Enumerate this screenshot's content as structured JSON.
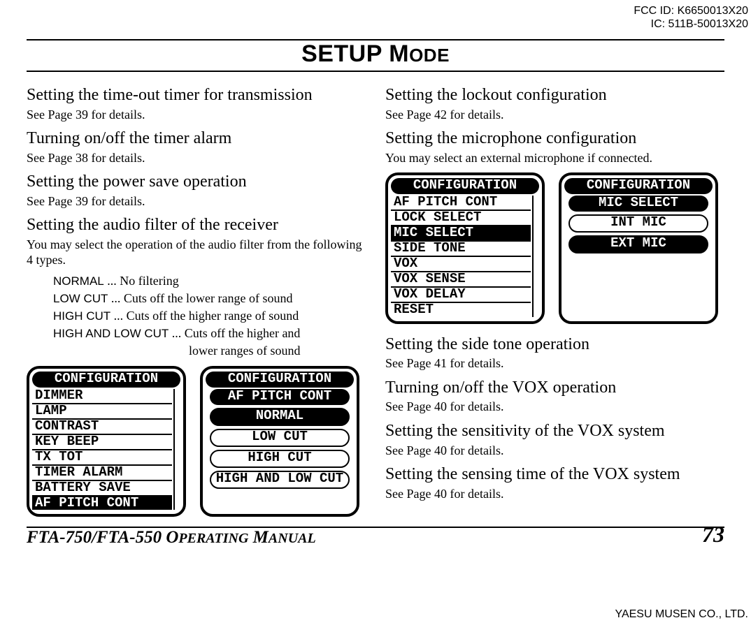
{
  "ids": {
    "fcc": "FCC ID: K6650013X20",
    "ic": "IC: 511B-50013X20"
  },
  "title": {
    "big": "SETUP M",
    "sc": "ODE"
  },
  "left": {
    "s1_h": "Setting the time-out timer for transmission",
    "s1_t": "See Page 39 for details.",
    "s2_h": "Turning on/off the timer alarm",
    "s2_t": "See Page 38 for details.",
    "s3_h": "Setting the power save operation",
    "s3_t": "See Page 39 for details.",
    "s4_h": "Setting the audio filter of the receiver",
    "s4_t": "You may select the operation of the audio filter from the following 4 types.",
    "filters": {
      "normal_lbl": "NORMAL",
      "normal_desc": " ... No filtering",
      "low_lbl": "LOW CUT",
      "low_desc": " ... Cuts off the lower range of sound",
      "high_lbl": "HIGH CUT",
      "high_desc": " ... Cuts off the higher range of sound",
      "hl_lbl": "HIGH AND LOW CUT",
      "hl_desc1": " ... Cuts off the higher and",
      "hl_desc2": "lower ranges of sound"
    },
    "panel_list": {
      "title": "CONFIGURATION",
      "items": [
        "DIMMER",
        "LAMP",
        "CONTRAST",
        "KEY BEEP",
        "TX TOT",
        "TIMER ALARM",
        "BATTERY SAVE",
        "AF PITCH CONT"
      ],
      "selected_index": 7
    },
    "panel_options": {
      "title": "CONFIGURATION",
      "sub": "AF PITCH CONT",
      "options": [
        "NORMAL",
        "LOW CUT",
        "HIGH CUT",
        "HIGH AND LOW CUT"
      ],
      "selected_index": 0
    }
  },
  "right": {
    "s1_h": "Setting the lockout configuration",
    "s1_t": "See Page 42 for details.",
    "s2_h": "Setting the microphone configuration",
    "s2_t": "You may select an external microphone if connected.",
    "panel_list": {
      "title": "CONFIGURATION",
      "items": [
        "AF PITCH CONT",
        "LOCK SELECT",
        "MIC SELECT",
        "SIDE TONE",
        "VOX",
        "VOX SENSE",
        "VOX DELAY",
        "RESET"
      ],
      "selected_index": 2
    },
    "panel_options": {
      "title": "CONFIGURATION",
      "sub": "MIC SELECT",
      "options": [
        "INT MIC",
        "EXT MIC"
      ],
      "selected_index": 1
    },
    "s3_h": "Setting the side tone operation",
    "s3_t": "See Page 41 for details.",
    "s4_h": "Turning on/off the VOX operation",
    "s4_t": "See Page 40 for details.",
    "s5_h": "Setting the sensitivity of the VOX system",
    "s5_t": "See Page 40 for details.",
    "s6_h": "Setting the sensing time of the VOX system",
    "s6_t": "See Page 40 for details."
  },
  "footer": {
    "manual_a": "FTA-750/FTA-550 O",
    "manual_b": "PERATING",
    "manual_c": " M",
    "manual_d": "ANUAL",
    "page": "73",
    "company": "YAESU MUSEN CO., LTD."
  }
}
